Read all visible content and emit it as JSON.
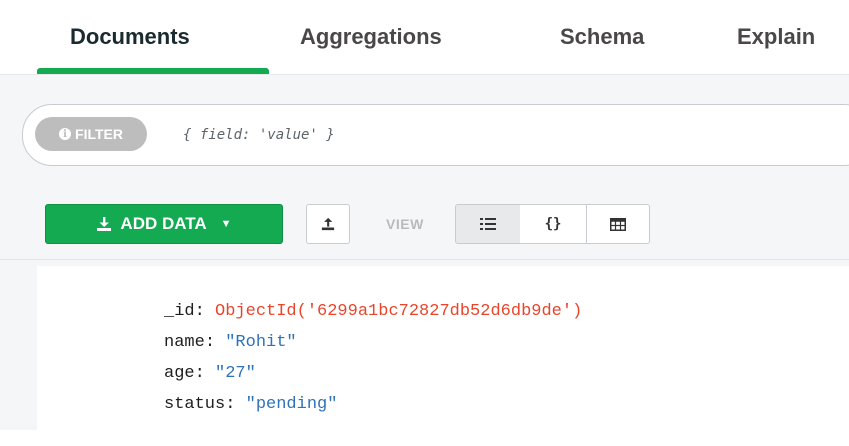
{
  "tabs": [
    {
      "label": "Documents"
    },
    {
      "label": "Aggregations"
    },
    {
      "label": "Schema"
    },
    {
      "label": "Explain"
    }
  ],
  "filter": {
    "pill_label": "FILTER",
    "info_glyph": "i",
    "placeholder": "{ field: 'value' }"
  },
  "toolbar": {
    "add_data_label": "ADD DATA",
    "add_data_icon": "download-icon",
    "import_icon": "upload-icon",
    "view_label": "VIEW",
    "view_modes": [
      {
        "icon": "list-view-icon",
        "glyph": "☰"
      },
      {
        "icon": "json-view-icon",
        "glyph": "{}"
      },
      {
        "icon": "table-view-icon",
        "glyph": "▦"
      }
    ]
  },
  "document": {
    "fields": [
      {
        "key": "_id",
        "value": "ObjectId('6299a1bc72827db52d6db9de')",
        "type": "objectid"
      },
      {
        "key": "name",
        "value": "\"Rohit\"",
        "type": "string"
      },
      {
        "key": "age",
        "value": "\"27\"",
        "type": "string"
      },
      {
        "key": "status",
        "value": "\"pending\"",
        "type": "string"
      }
    ]
  },
  "colors": {
    "accent": "#13aa52",
    "objectid": "#e8452c",
    "string": "#2f72b8"
  }
}
